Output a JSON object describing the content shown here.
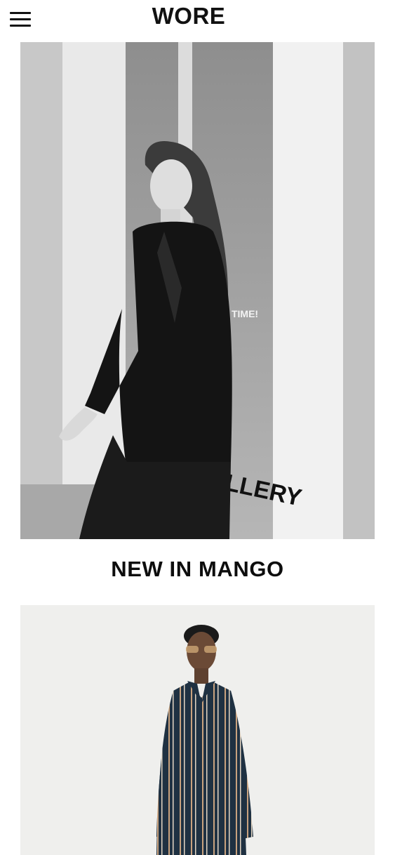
{
  "header": {
    "logo": "WORE",
    "menu_icon": "hamburger-menu-icon"
  },
  "hero": {
    "image_alt": "Black and white photo of a woman in a dark suit walking past a gallery window",
    "window_text_1": "Y TIME!",
    "window_text_2": "LLERY"
  },
  "section": {
    "title": "NEW IN MANGO"
  },
  "product": {
    "image_alt": "Model wearing a navy striped long shirt dress"
  }
}
